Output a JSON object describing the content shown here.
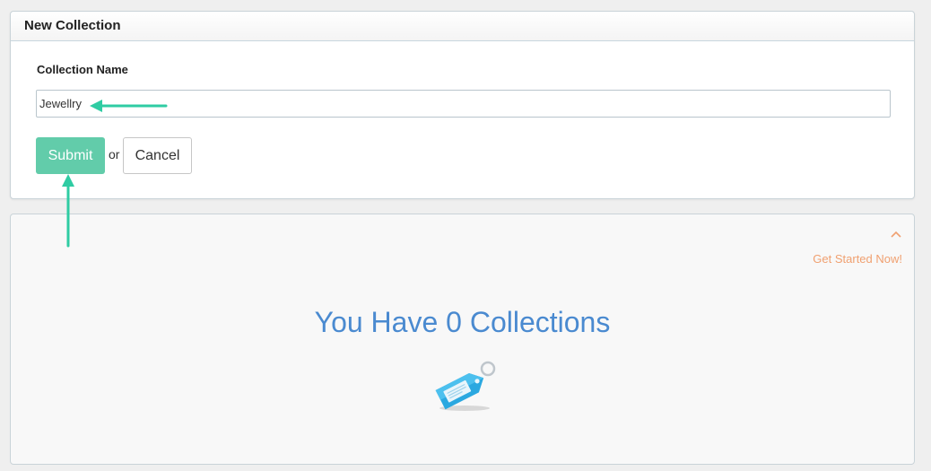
{
  "new_collection": {
    "title": "New Collection",
    "field_label": "Collection Name",
    "name_value": "Jewellry",
    "submit_label": "Submit",
    "or_text": "or",
    "cancel_label": "Cancel"
  },
  "collections_panel": {
    "get_started_label": "Get Started Now!",
    "empty_message": "You Have 0 Collections",
    "collapse_icon": "chevron-up-icon",
    "empty_icon": "tag-icon"
  },
  "colors": {
    "submit_button": "#62ccaa",
    "annotation_arrow": "#2fcca3",
    "empty_message": "#4a8ad0",
    "get_started_link": "#f0a070"
  }
}
